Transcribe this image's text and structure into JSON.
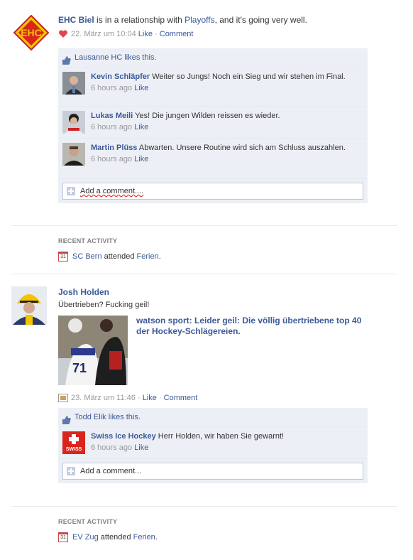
{
  "story1": {
    "author": "EHC Biel",
    "mid1": " is in a relationship with ",
    "target": "Playoffs",
    "mid2": ", and it's going very well.",
    "timestamp": "22. März um 10:04",
    "like": "Like",
    "sep": " · ",
    "comment": "Comment",
    "likes_text": "Lausanne HC likes this.",
    "comments": [
      {
        "author": "Kevin Schläpfer",
        "text": "Weiter so Jungs! Noch ein Sieg und wir stehen im Final.",
        "time": "6 hours ago",
        "like": "Like"
      },
      {
        "author": "Lukas Meili",
        "text": "Yes! Die jungen Wilden reissen es wieder.",
        "time": "6 hours ago",
        "like": "Like"
      },
      {
        "author": "Martin Plüss",
        "text": "Abwarten. Unsere Routine wird sich am Schluss auszahlen.",
        "time": "6 hours ago",
        "like": "Like"
      }
    ],
    "add_comment": "Add a comment...."
  },
  "recent1": {
    "title": "RECENT ACTIVITY",
    "actor": "SC Bern",
    "verb": " attended ",
    "event": "Ferien",
    "end": "."
  },
  "story2": {
    "author": "Josh Holden",
    "text": "Übertrieben? Fucking geil!",
    "link_title": "watson sport: Leider geil: Die völlig übertriebene top 40 der Hockey-Schlägereien.",
    "timestamp": "23. März um 11:46",
    "sep": " · ",
    "like": "Like",
    "comment": "Comment",
    "likes_text": "Todd Elik likes this.",
    "comments": [
      {
        "author": "Swiss Ice Hockey",
        "text": "Herr Holden, wir haben Sie gewarnt!",
        "time": "6 hours ago",
        "like": "Like"
      }
    ],
    "add_comment": "Add a comment..."
  },
  "recent2": {
    "title": "RECENT ACTIVITY",
    "actor": "EV Zug",
    "verb": " attended ",
    "event": "Ferien",
    "end": "."
  },
  "icons": {
    "calendar_day": "31",
    "swiss_logo_text": "SWISS"
  },
  "colors": {
    "link": "#3b5998",
    "ufi_bg": "#eceff5",
    "heart": "#e0474c"
  }
}
